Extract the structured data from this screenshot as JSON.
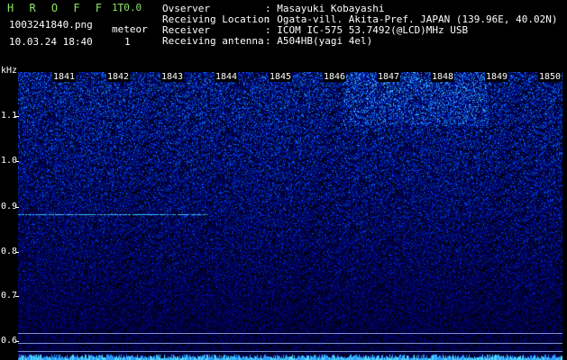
{
  "header": {
    "app_title": "H R O F F T",
    "version": "1.0.0",
    "filename": "1003241840.png",
    "timestamp": "10.03.24 18:40",
    "event_type": "meteor",
    "event_count": "1",
    "meta": [
      {
        "label": "Ovserver",
        "value": ": Masayuki Kobayashi"
      },
      {
        "label": "Receiving Location",
        "value": ": Ogata-vill. Akita-Pref. JAPAN (139.96E, 40.02N)"
      },
      {
        "label": "Receiver",
        "value": ": ICOM IC-575 53.7492(@LCD)MHz USB"
      },
      {
        "label": "Receiving antenna",
        "value": ": A504HB(yagi 4el)"
      }
    ]
  },
  "spectrogram": {
    "unit": "kHz",
    "y_ticks": [
      "1.1",
      "1.0",
      "0.9",
      "0.8",
      "0.7",
      "0.6"
    ],
    "time_ticks": [
      "1841",
      "1842",
      "1843",
      "1844",
      "1845",
      "1846",
      "1847",
      "1848",
      "1849",
      "1850"
    ],
    "colors": {
      "background": "#000000",
      "label": "#8fe36a",
      "text": "#ffffff",
      "signal_line": "#3fc0ff"
    }
  }
}
